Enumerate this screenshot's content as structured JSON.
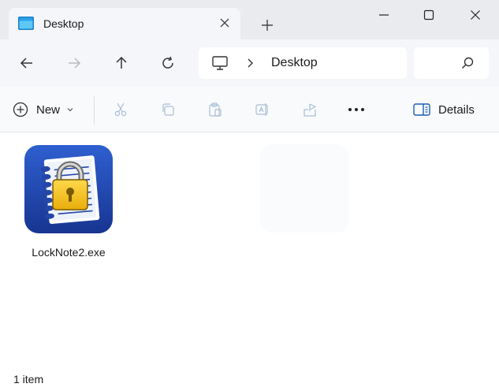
{
  "window": {
    "tab_title": "Desktop",
    "icons": {
      "tab": "desktop-folder-icon",
      "close_tab": "close-icon",
      "new_tab": "plus-icon",
      "minimize": "minimize-icon",
      "maximize": "maximize-icon",
      "close": "close-icon"
    }
  },
  "navigation": {
    "address_segment": "Desktop",
    "icons": {
      "back": "arrow-left-icon",
      "forward": "arrow-right-icon",
      "up": "arrow-up-icon",
      "refresh": "refresh-icon",
      "location": "this-pc-icon",
      "separator": "chevron-right-icon",
      "search": "search-icon"
    }
  },
  "command_bar": {
    "new_label": "New",
    "details_label": "Details",
    "icons": [
      "plus-circle-icon",
      "chevron-down-icon",
      "cut-icon",
      "copy-icon",
      "paste-icon",
      "rename-icon",
      "share-icon",
      "more-icon",
      "details-pane-icon"
    ]
  },
  "files": [
    {
      "name": "LockNote2.exe",
      "icon": "locknote-app-icon"
    }
  ],
  "status": {
    "item_count": "1 item"
  },
  "colors": {
    "titlebar": "#e9ebef",
    "toolbar": "#f4f6f9",
    "app_icon_blue": "#1a3d9e",
    "lock_yellow": "#f5c518"
  }
}
